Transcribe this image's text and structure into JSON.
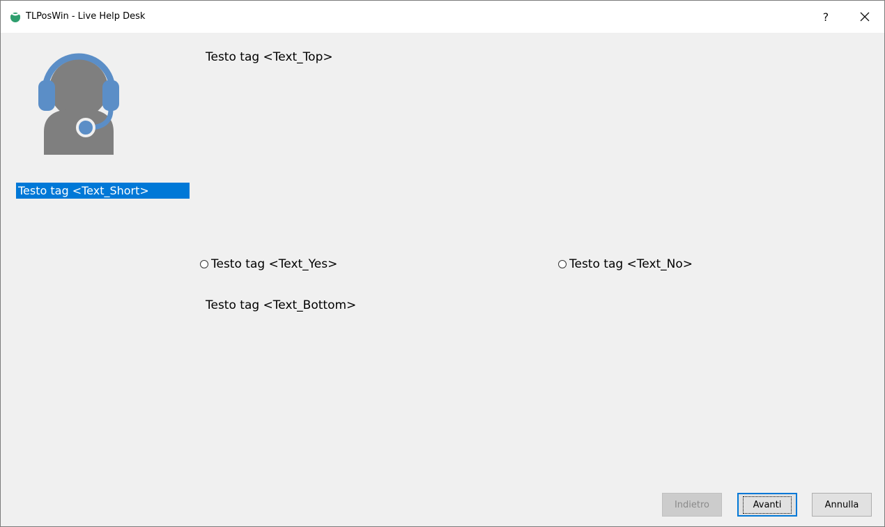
{
  "window": {
    "title": "TLPosWin - Live Help Desk",
    "help_label": "?",
    "close_label": "✕"
  },
  "main": {
    "text_top": "Testo tag <Text_Top>",
    "text_short": "Testo tag <Text_Short>",
    "radio_yes": "Testo tag <Text_Yes>",
    "radio_no": "Testo tag <Text_No>",
    "text_bottom": "Testo tag <Text_Bottom>"
  },
  "buttons": {
    "back": "Indietro",
    "next": "Avanti",
    "cancel": "Annulla"
  },
  "colors": {
    "accent": "#0078d7",
    "avatar_headset": "#5b8ec7",
    "avatar_body": "#7f7f7f",
    "app_icon": "#2e9e6e"
  },
  "icons": {
    "app": "tlposwin-logo-icon",
    "avatar": "support-agent-headset-icon"
  }
}
